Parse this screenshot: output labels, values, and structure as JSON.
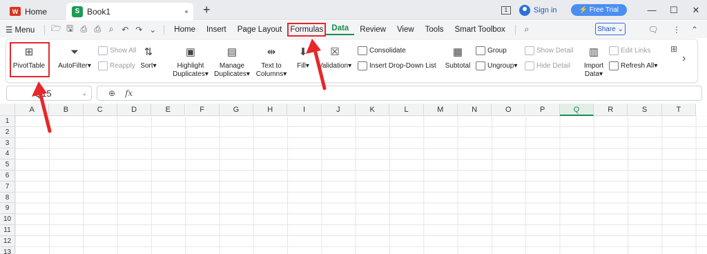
{
  "titlebar": {
    "home_tab": "Home",
    "home_logo": "W",
    "book_tab": "Book1",
    "book_logo": "S",
    "new_tab": "+",
    "badge": "1",
    "sign_in": "Sign in",
    "free_trial": "Free Trial"
  },
  "menubar": {
    "menu_label": "Menu",
    "items": [
      "Home",
      "Insert",
      "Page Layout",
      "Formulas",
      "Data",
      "Review",
      "View",
      "Tools",
      "Smart Toolbox"
    ],
    "active": "Data",
    "share": "Share"
  },
  "ribbon": {
    "pivottable": "PivotTable",
    "autofilter": "AutoFilter",
    "show_all": "Show All",
    "reapply": "Reapply",
    "sort": "Sort",
    "highlight_1": "Highlight",
    "highlight_2": "Duplicates",
    "manage_1": "Manage",
    "manage_2": "Duplicates",
    "text_1": "Text to",
    "text_2": "Columns",
    "fill": "Fill",
    "validation": "Validation",
    "consolidate": "Consolidate",
    "insert_dropdown": "Insert Drop-Down List",
    "subtotal": "Subtotal",
    "group": "Group",
    "ungroup": "Ungroup",
    "show_detail": "Show Detail",
    "hide_detail": "Hide Detail",
    "import_1": "Import",
    "import_2": "Data",
    "edit_links": "Edit Links",
    "refresh_all": "Refresh All"
  },
  "formula_bar": {
    "name_box": "Q15",
    "fx": "fx"
  },
  "grid": {
    "columns": [
      "A",
      "B",
      "C",
      "D",
      "E",
      "F",
      "G",
      "H",
      "I",
      "J",
      "K",
      "L",
      "M",
      "N",
      "O",
      "P",
      "Q",
      "R",
      "S",
      "T"
    ],
    "rows": [
      "1",
      "2",
      "3",
      "4",
      "5",
      "6",
      "7",
      "8",
      "9",
      "10",
      "11",
      "12",
      "13"
    ],
    "selected_column": "Q"
  },
  "colors": {
    "accent": "#1c8c4d",
    "highlight": "#e8262b",
    "link": "#1f56c4"
  }
}
